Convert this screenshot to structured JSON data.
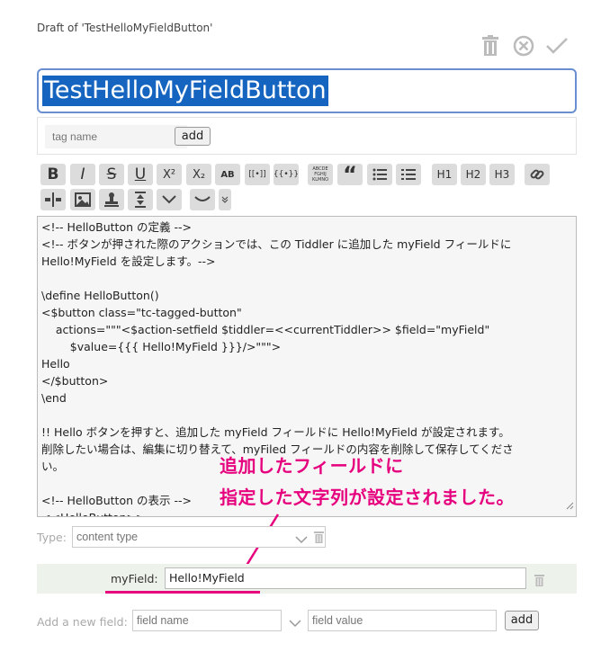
{
  "draft_label": "Draft of 'TestHelloMyFieldButton'",
  "title": "TestHelloMyFieldButton",
  "tag": {
    "placeholder": "tag name",
    "add_label": "add"
  },
  "toolbar": {
    "bold": "B",
    "italic": "I",
    "strike": "S",
    "underline": "U",
    "sup": "X²",
    "sub": "X₂",
    "smallcaps": "AB",
    "transclude": "[[•]]",
    "macro": "{{•}}",
    "mono": "ABCDE FGHIJ KLMNO",
    "h1": "H1",
    "h2": "H2",
    "h3": "H3"
  },
  "editor_lines": [
    "<!-- HelloButton の定義 -->",
    "<!-- ボタンが押された際のアクションでは、この Tiddler に追加した myField フィールドに",
    "Hello!MyField を設定します。-->",
    "",
    "\\define HelloButton()",
    "<$button class=\"tc-tagged-button\"",
    "    actions=\"\"\"<$action-setfield $tiddler=<<currentTiddler>> $field=\"myField\"",
    "        $value={{{ Hello!MyField }}}/>\"\"\">",
    "Hello",
    "</$button>",
    "\\end",
    "",
    "!! Hello ボタンを押すと、追加した myField フィールドに Hello!MyField が設定されます。",
    "削除したい場合は、編集に切り替えて、myFiled フィールドの内容を削除して保存してくださ",
    "い。",
    "",
    "<!-- HelloButton の表示 -->",
    "<<HelloButton>>"
  ],
  "annotation": {
    "line1": "追加したフィールドに",
    "line2": "指定した文字列が設定されました。"
  },
  "type_row": {
    "label": "Type:",
    "placeholder": "content type"
  },
  "field": {
    "name": "myField:",
    "value": "Hello!MyField"
  },
  "new_field": {
    "label": "Add a new field:",
    "name_placeholder": "field name",
    "value_placeholder": "field value",
    "add_label": "add"
  },
  "colors": {
    "accent": "#e6007e",
    "selection": "#1565c0",
    "border_focus": "#6a8fd0"
  }
}
